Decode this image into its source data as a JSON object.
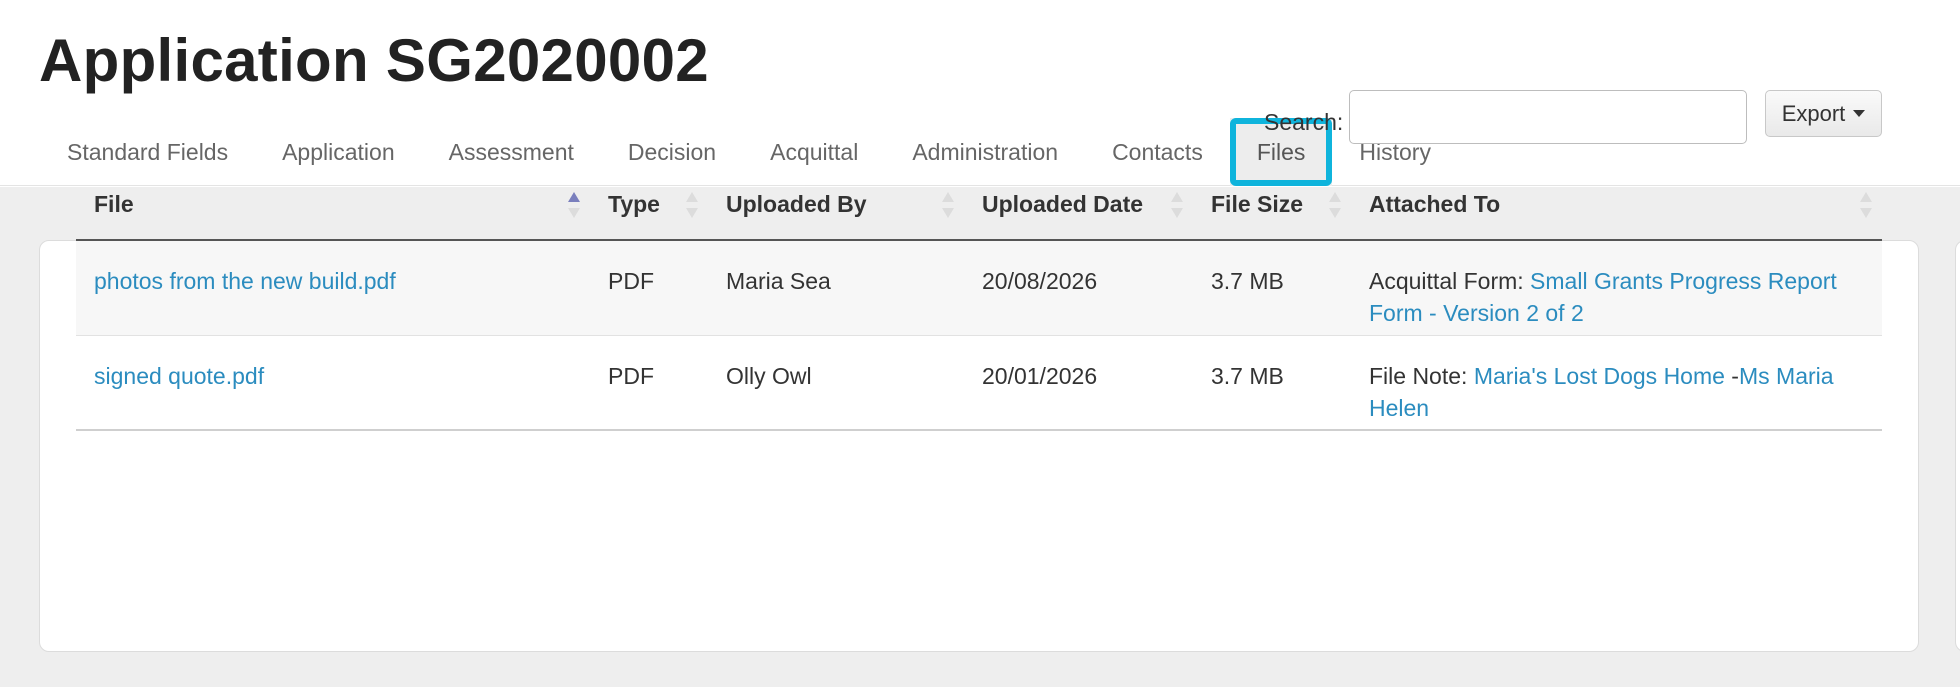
{
  "page": {
    "title": "Application SG2020002"
  },
  "tabs": [
    {
      "label": "Standard Fields"
    },
    {
      "label": "Application"
    },
    {
      "label": "Assessment"
    },
    {
      "label": "Decision"
    },
    {
      "label": "Acquittal"
    },
    {
      "label": "Administration"
    },
    {
      "label": "Contacts"
    },
    {
      "label": "Files",
      "active": true
    },
    {
      "label": "History"
    }
  ],
  "toolbar": {
    "search_label": "Search:",
    "search_value": "",
    "export_label": "Export"
  },
  "table": {
    "columns": [
      {
        "label": "File",
        "sort": "asc"
      },
      {
        "label": "Type",
        "sort": "none"
      },
      {
        "label": "Uploaded By",
        "sort": "none"
      },
      {
        "label": "Uploaded Date",
        "sort": "none"
      },
      {
        "label": "File Size",
        "sort": "none"
      },
      {
        "label": "Attached To",
        "sort": "none"
      }
    ],
    "rows": [
      {
        "file": "photos from the new build.pdf",
        "type": "PDF",
        "uploaded_by": "Maria Sea",
        "uploaded_date": "20/08/2026",
        "file_size": "3.7 MB",
        "attached_prefix": "Acquittal Form: ",
        "attached_link": "Small Grants Progress Report Form - Version 2 of 2",
        "attached_sep": "",
        "attached_link2": ""
      },
      {
        "file": "signed quote.pdf",
        "type": "PDF",
        "uploaded_by": "Olly Owl",
        "uploaded_date": "20/01/2026",
        "file_size": "3.7 MB",
        "attached_prefix": "File Note: ",
        "attached_link": "Maria's Lost Dogs Home",
        "attached_sep": " -",
        "attached_link2": "Ms Maria Helen"
      }
    ]
  },
  "colors": {
    "active_tab_outline": "#0fb4dc",
    "link": "#2b8cbf",
    "sort_active": "#7a7fbd",
    "content_bg": "#eeeeee"
  }
}
